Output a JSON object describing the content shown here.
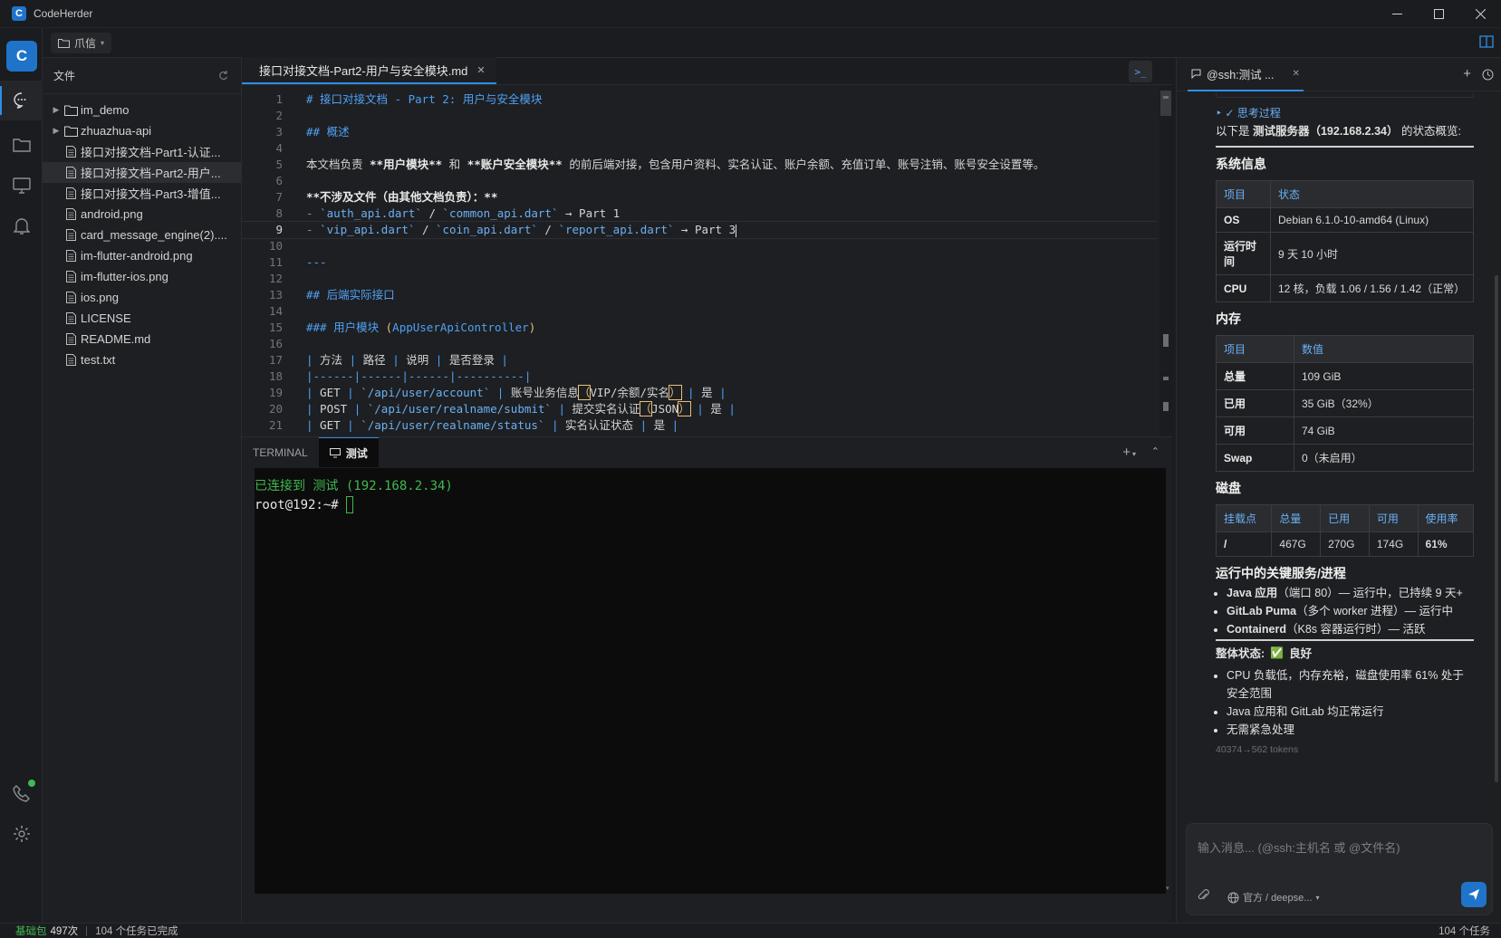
{
  "app": {
    "title": "CodeHerder",
    "logo_letter": "C"
  },
  "workspace": {
    "name": "爪信"
  },
  "explorer": {
    "title": "文件",
    "items": [
      {
        "label": "im_demo",
        "type": "folder"
      },
      {
        "label": "zhuazhua-api",
        "type": "folder"
      },
      {
        "label": "接口对接文档-Part1-认证...",
        "type": "file"
      },
      {
        "label": "接口对接文档-Part2-用户...",
        "type": "file",
        "selected": true
      },
      {
        "label": "接口对接文档-Part3-增值...",
        "type": "file"
      },
      {
        "label": "android.png",
        "type": "file"
      },
      {
        "label": "card_message_engine(2)....",
        "type": "file"
      },
      {
        "label": "im-flutter-android.png",
        "type": "file"
      },
      {
        "label": "im-flutter-ios.png",
        "type": "file"
      },
      {
        "label": "ios.png",
        "type": "file"
      },
      {
        "label": "LICENSE",
        "type": "file"
      },
      {
        "label": "README.md",
        "type": "file"
      },
      {
        "label": "test.txt",
        "type": "file"
      }
    ]
  },
  "editor": {
    "tab_label": "接口对接文档-Part2-用户与安全模块.md",
    "terminal_button": ">_",
    "current_line": 9,
    "lines": [
      {
        "n": "1",
        "text": "# 接口对接文档 - Part 2: 用户与安全模块"
      },
      {
        "n": "2",
        "text": ""
      },
      {
        "n": "3",
        "text": "## 概述"
      },
      {
        "n": "4",
        "text": ""
      },
      {
        "n": "5",
        "text": "本文档负责 **用户模块** 和 **账户安全模块** 的前后端对接，包含用户资料、实名认证、账户余额、充值订单、账号注销、账号安全设置等。"
      },
      {
        "n": "6",
        "text": ""
      },
      {
        "n": "7",
        "text": "**不涉及文件（由其他文档负责）：**"
      },
      {
        "n": "8",
        "text": "- `auth_api.dart` / `common_api.dart` → Part 1"
      },
      {
        "n": "9",
        "text": "- `vip_api.dart` / `coin_api.dart` / `report_api.dart` → Part 3"
      },
      {
        "n": "10",
        "text": ""
      },
      {
        "n": "11",
        "text": "---"
      },
      {
        "n": "12",
        "text": ""
      },
      {
        "n": "13",
        "text": "## 后端实际接口"
      },
      {
        "n": "14",
        "text": ""
      },
      {
        "n": "15",
        "text": "### 用户模块 (AppUserApiController)"
      },
      {
        "n": "16",
        "text": ""
      },
      {
        "n": "17",
        "text": "| 方法 | 路径 | 说明 | 是否登录 |"
      },
      {
        "n": "18",
        "text": "|------|------|------|----------|"
      },
      {
        "n": "19",
        "text": "| GET | `/api/user/account` | 账号业务信息（VIP/余额/实名） | 是 |"
      },
      {
        "n": "20",
        "text": "| POST | `/api/user/realname/submit` | 提交实名认证（JSON） | 是 |"
      },
      {
        "n": "21",
        "text": "| GET | `/api/user/realname/status` | 实名认证状态 | 是 |"
      }
    ]
  },
  "terminal": {
    "tab_terminal": "TERMINAL",
    "tab_session": "测试",
    "connected_line": "已连接到 测试 (192.168.2.34)",
    "prompt": "root@192:~# "
  },
  "chat": {
    "tab_label": "@ssh:测试 ...",
    "thinking_label": "思考过程",
    "intro_prefix": "以下是 ",
    "intro_bold": "测试服务器（192.168.2.34）",
    "intro_suffix": " 的状态概览:",
    "sys_title": "系统信息",
    "sys_headers": [
      "项目",
      "状态"
    ],
    "sys_rows": [
      [
        "OS",
        "Debian 6.1.0-10-amd64 (Linux)"
      ],
      [
        "运行时间",
        "9 天 10 小时"
      ],
      [
        "CPU",
        "12 核，负载 1.06 / 1.56 / 1.42（正常）"
      ]
    ],
    "mem_title": "内存",
    "mem_headers": [
      "项目",
      "数值"
    ],
    "mem_rows": [
      [
        "总量",
        "109 GiB"
      ],
      [
        "已用",
        "35 GiB（32%）"
      ],
      [
        "可用",
        "74 GiB"
      ],
      [
        "Swap",
        "0（未启用）"
      ]
    ],
    "disk_title": "磁盘",
    "disk_headers": [
      "挂载点",
      "总量",
      "已用",
      "可用",
      "使用率"
    ],
    "disk_rows": [
      [
        "/",
        "467G",
        "270G",
        "174G",
        "61%"
      ]
    ],
    "svc_title": "运行中的关键服务/进程",
    "services": [
      {
        "name": "Java 应用",
        "detail": "（端口 80）— 运行中，已持续 9 天+"
      },
      {
        "name": "GitLab Puma",
        "detail": "（多个 worker 进程）— 运行中"
      },
      {
        "name": "Containerd",
        "detail": "（K8s 容器运行时）— 活跃"
      }
    ],
    "overall_label": "整体状态:",
    "overall_check": "✅",
    "overall_value": "良好",
    "summary": [
      "CPU 负载低，内存充裕，磁盘使用率 61% 处于安全范围",
      "Java 应用和 GitLab 均正常运行",
      "无需紧急处理"
    ],
    "tokens": "40374→562 tokens",
    "input_placeholder": "输入消息... (@ssh:主机名 或 @文件名)",
    "model_label": "官方 / deepse..."
  },
  "status": {
    "left_label": "基础包",
    "left_count": "497次",
    "tasks_done": "104 个任务已完成",
    "right_tasks": "104 个任务"
  },
  "colors": {
    "accent": "#2f8ee5",
    "green": "#3fb950"
  }
}
